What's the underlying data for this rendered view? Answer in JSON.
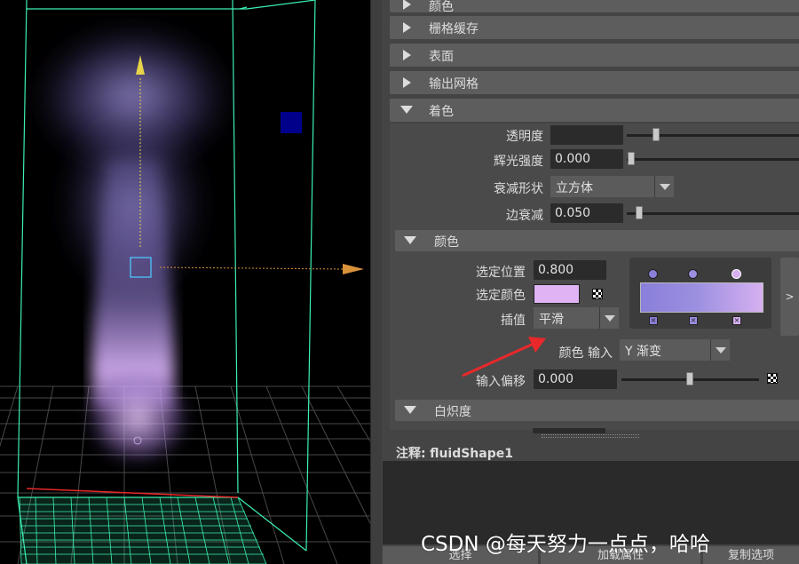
{
  "editor": {
    "sections": {
      "top_partial": "颜色",
      "grid_cache": "栅格缓存",
      "surface": "表面",
      "output_mesh": "输出网格",
      "shading": "着色",
      "incandescence": "白炽度"
    },
    "shading": {
      "transparency_label": "透明度",
      "glow_intensity_label": "辉光强度",
      "glow_intensity_value": "0.000",
      "dropoff_shape_label": "衰减形状",
      "dropoff_shape_value": "立方体",
      "edge_dropoff_label": "边衰减",
      "edge_dropoff_value": "0.050"
    },
    "color": {
      "header": "颜色",
      "selected_position_label": "选定位置",
      "selected_position_value": "0.800",
      "selected_color_label": "选定颜色",
      "selected_color_hex": "#e0b3f5",
      "interpolation_label": "插值",
      "interpolation_value": "平滑",
      "color_input_label": "颜色 输入",
      "color_input_value": "Y 渐变",
      "input_bias_label": "输入偏移",
      "input_bias_value": "0.000",
      "ramp_colors": [
        "#8a7fd9",
        "#9b8fe0",
        "#d6b0f0"
      ],
      "side_button": ">"
    },
    "notes": {
      "label": "注释:",
      "shape": "fluidShape1"
    },
    "bottom_buttons": [
      "选择",
      "加载属性",
      "复制选项"
    ]
  },
  "watermark": "CSDN @每天努力一点点，哈哈",
  "colors": {
    "accent_cube": "#00008b",
    "wireframe": "#3cf0b0",
    "manip_y": "#e8d44a",
    "manip_x": "#d9913a",
    "red_arrow": "#e8282a"
  }
}
